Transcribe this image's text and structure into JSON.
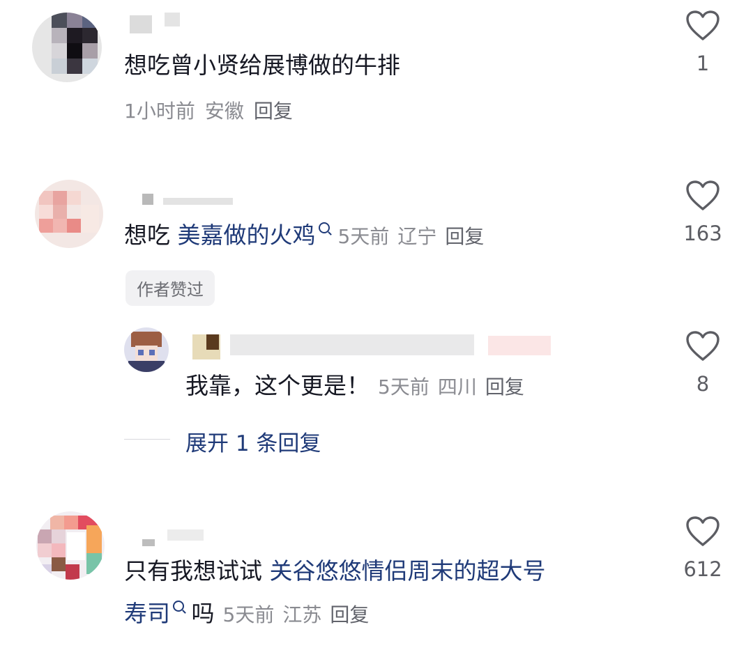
{
  "comments": [
    {
      "content": "想吃曾小贤给展博做的牛排",
      "time": "1小时前",
      "location": "安徽",
      "reply_label": "回复",
      "likes": "1"
    },
    {
      "content_prefix": "想吃 ",
      "content_link": "美嘉做的火鸡",
      "time": "5天前",
      "location": "辽宁",
      "reply_label": "回复",
      "likes": "163",
      "badge": "作者赞过",
      "sub_reply": {
        "content": "我靠，这个更是！",
        "time": "5天前",
        "location": "四川",
        "reply_label": "回复",
        "likes": "8"
      },
      "expand_label": "展开 1 条回复"
    },
    {
      "content_prefix": "只有我想试试 ",
      "content_link_line1": "关谷悠悠情侣周末的超大号",
      "content_link_line2": "寿司",
      "content_suffix": " 吗",
      "time": "5天前",
      "location": "江苏",
      "reply_label": "回复",
      "likes": "612"
    }
  ],
  "icons": {
    "like": "heart-outline-icon",
    "search": "search-icon"
  },
  "colors": {
    "link": "#1f3a78",
    "meta": "#8a8b91",
    "text": "#161823"
  }
}
